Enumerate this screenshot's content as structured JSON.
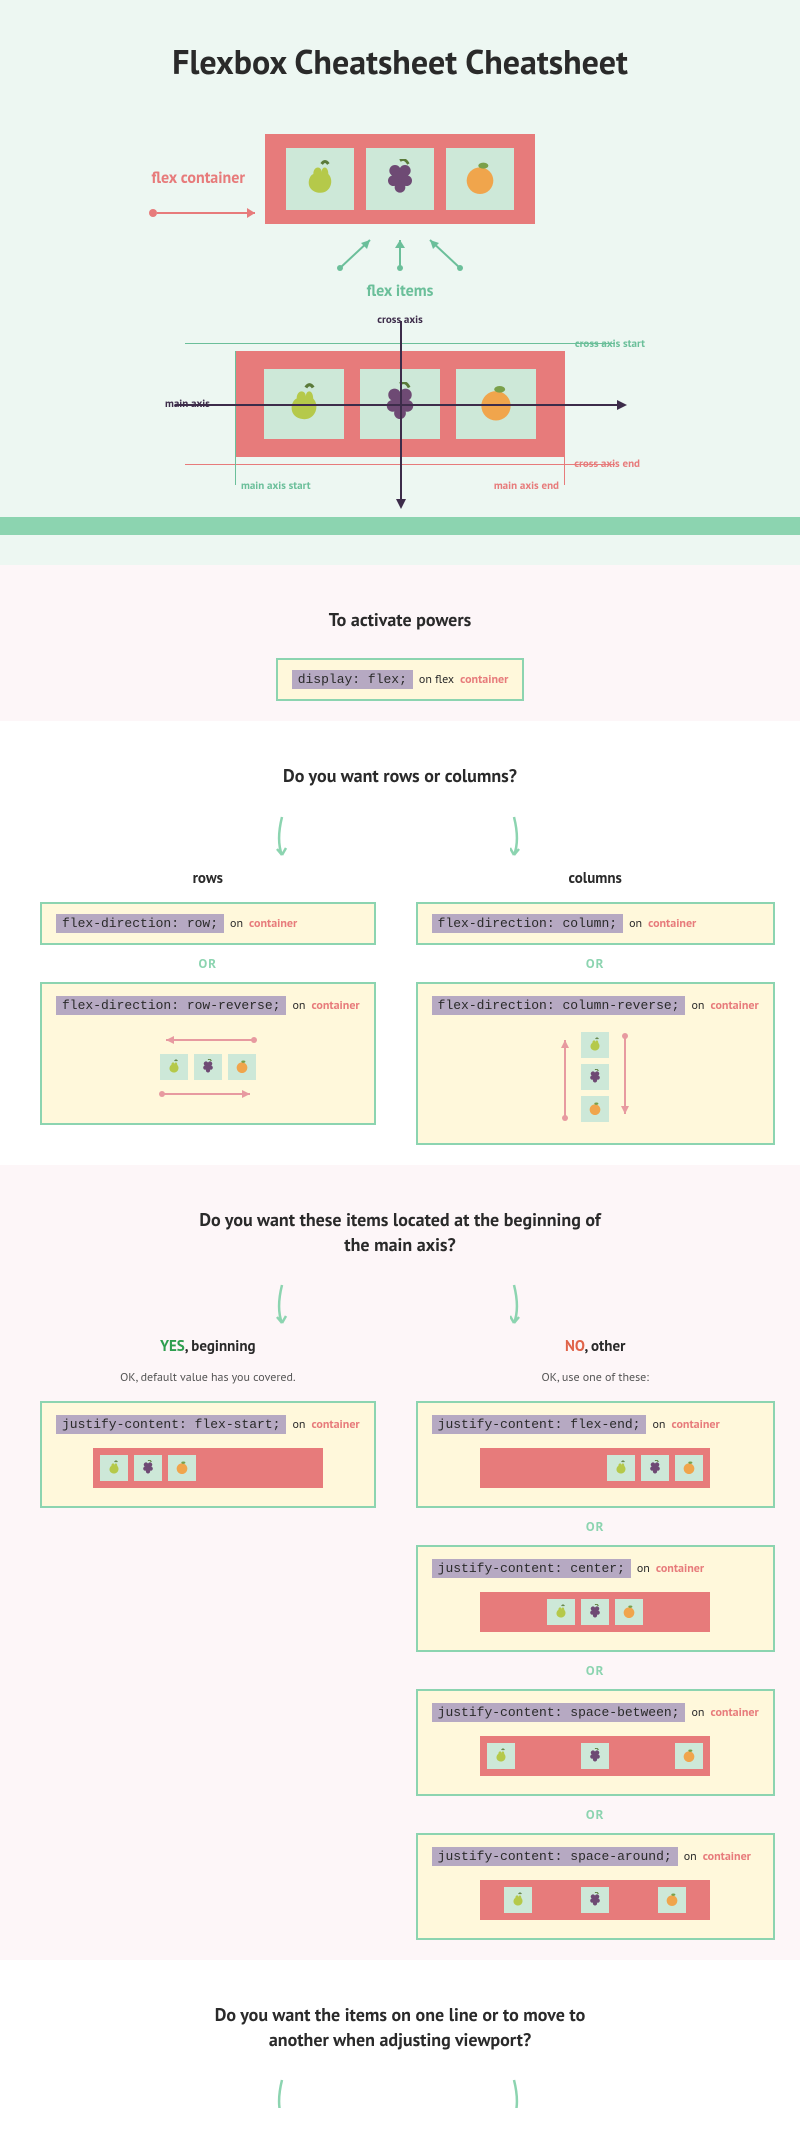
{
  "title": "Flexbox Cheatsheet Cheatsheet",
  "labels": {
    "flex_container": "flex container",
    "flex_items": "flex items",
    "main_axis": "main axis",
    "cross_axis": "cross axis",
    "cross_axis_start": "cross axis start",
    "cross_axis_end": "cross axis end",
    "main_axis_start": "main axis start",
    "main_axis_end": "main axis end",
    "on": "on",
    "on_flex": "on flex",
    "container": "container",
    "or": "OR"
  },
  "sections": {
    "activate": {
      "heading": "To activate powers",
      "code": "display: flex;"
    },
    "rows_or_cols": {
      "heading": "Do you want rows or columns?",
      "rows": {
        "label": "rows",
        "code1": "flex-direction: row;",
        "code2": "flex-direction: row-reverse;"
      },
      "cols": {
        "label": "columns",
        "code1": "flex-direction: column;",
        "code2": "flex-direction: column-reverse;"
      }
    },
    "justify": {
      "heading": "Do you want these items located at the beginning of the main axis?",
      "yes_label_1": "YES",
      "yes_label_2": ",  beginning",
      "no_label_1": "NO",
      "no_label_2": ", other",
      "yes_note": "OK, default value has you covered.",
      "no_note": "OK, use one of these:",
      "codes": {
        "start": "justify-content: flex-start;",
        "end": "justify-content: flex-end;",
        "center": "justify-content: center;",
        "between": "justify-content: space-between;",
        "around": "justify-content: space-around;"
      }
    },
    "wrap": {
      "heading": "Do you want the items on one line or to move to another when adjusting viewport?"
    }
  }
}
